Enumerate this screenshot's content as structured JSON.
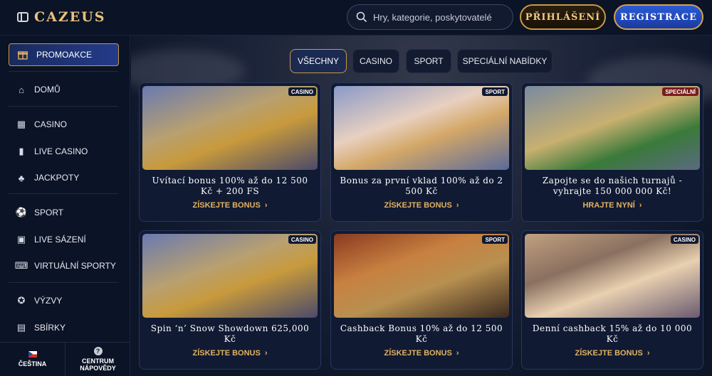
{
  "header": {
    "logo": "CAZEUS",
    "search_placeholder": "Hry, kategorie, poskytovatelé",
    "login_label": "PŘIHLÁŠENÍ",
    "register_label": "REGISTRACE"
  },
  "sidebar": {
    "promo_label": "PROMOAKCE",
    "items": [
      {
        "label": "DOMŮ",
        "icon": "bank-icon"
      },
      {
        "label": "CASINO",
        "icon": "slot-icon"
      },
      {
        "label": "LIVE CASINO",
        "icon": "cards-icon"
      },
      {
        "label": "JACKPOTY",
        "icon": "clover-icon"
      },
      {
        "label": "SPORT",
        "icon": "ball-icon"
      },
      {
        "label": "LIVE SÁZENÍ",
        "icon": "live-icon"
      },
      {
        "label": "VIRTUÁLNÍ SPORTY",
        "icon": "gamepad-icon"
      },
      {
        "label": "VÝZVY",
        "icon": "medal-icon"
      },
      {
        "label": "SBÍRKY",
        "icon": "gallery-icon"
      }
    ],
    "language": "ČEŠTINA",
    "help": "CENTRUM NÁPOVĚDY"
  },
  "tabs": [
    "VŠECHNY",
    "CASINO",
    "SPORT",
    "SPECIÁLNÍ NABÍDKY"
  ],
  "active_tab": "VŠECHNY",
  "cards": [
    {
      "badge": "CASINO",
      "title": "Uvítací bonus 100% až do 12 500 Kč + 200 FS",
      "cta": "ZÍSKEJTE BONUS"
    },
    {
      "badge": "SPORT",
      "title": "Bonus za první vklad 100% až do 2 500 Kč",
      "cta": "ZÍSKEJTE BONUS"
    },
    {
      "badge": "SPECIÁLNÍ",
      "title": "Zapojte se do našich turnajů - vyhrajte 150 000 000 Kč!",
      "cta": "HRAJTE NYNÍ"
    },
    {
      "badge": "CASINO",
      "title": "Spin ‘n’ Snow Showdown 625,000 Kč",
      "cta": "ZÍSKEJTE BONUS"
    },
    {
      "badge": "SPORT",
      "title": "Cashback Bonus 10% až do 12 500 Kč",
      "cta": "ZÍSKEJTE BONUS"
    },
    {
      "badge": "CASINO",
      "title": "Denní cashback 15% až do 10 000 Kč",
      "cta": "ZÍSKEJTE BONUS"
    }
  ],
  "colors": {
    "gold": "#c99a45",
    "blue": "#2b5bd6",
    "bg": "#0d1529"
  }
}
